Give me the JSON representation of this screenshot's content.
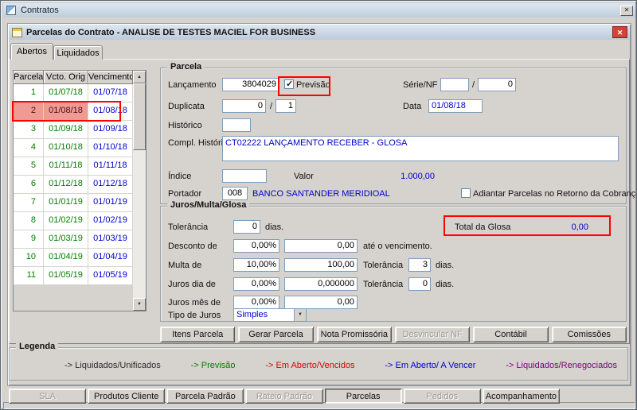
{
  "colors": {
    "annotation": "#ff0000",
    "parcela_number": "#007d00",
    "vcto_date": "#007d00",
    "venc_date": "#0000cc",
    "selected_bg": "#f09a94",
    "blue_value": "#0000cc"
  },
  "icons": {
    "close": "✕",
    "arrow_up": "▲",
    "arrow_down": "▼",
    "combo_arrow": "▼"
  },
  "outer_window": {
    "title": "Contratos"
  },
  "inner_window": {
    "title": "Parcelas do Contrato - ANALISE DE TESTES MACIEL FOR BUSINESS"
  },
  "tabs": {
    "abertos": "Abertos",
    "liquidados": "Liquidados"
  },
  "table": {
    "headers": [
      "Parcela",
      "Vcto. Orig",
      "Vencimento"
    ],
    "rows": [
      {
        "parcela": "1",
        "vcto": "01/07/18",
        "venc": "01/07/18",
        "selected": false
      },
      {
        "parcela": "2",
        "vcto": "01/08/18",
        "venc": "01/08/18",
        "selected": true
      },
      {
        "parcela": "3",
        "vcto": "01/09/18",
        "venc": "01/09/18",
        "selected": false
      },
      {
        "parcela": "4",
        "vcto": "01/10/18",
        "venc": "01/10/18",
        "selected": false
      },
      {
        "parcela": "5",
        "vcto": "01/11/18",
        "venc": "01/11/18",
        "selected": false
      },
      {
        "parcela": "6",
        "vcto": "01/12/18",
        "venc": "01/12/18",
        "selected": false
      },
      {
        "parcela": "7",
        "vcto": "01/01/19",
        "venc": "01/01/19",
        "selected": false
      },
      {
        "parcela": "8",
        "vcto": "01/02/19",
        "venc": "01/02/19",
        "selected": false
      },
      {
        "parcela": "9",
        "vcto": "01/03/19",
        "venc": "01/03/19",
        "selected": false
      },
      {
        "parcela": "10",
        "vcto": "01/04/19",
        "venc": "01/04/19",
        "selected": false
      },
      {
        "parcela": "11",
        "vcto": "01/05/19",
        "venc": "01/05/19",
        "selected": false
      }
    ]
  },
  "parcela": {
    "group_title": "Parcela",
    "lancamento": {
      "label": "Lançamento",
      "value": "3804029"
    },
    "previsao": {
      "label": "Previsão",
      "checked": true
    },
    "serie_nf": {
      "label": "Série/NF",
      "value1": "",
      "sep": "/",
      "value2": "0"
    },
    "duplicata": {
      "label": "Duplicata",
      "value": "0",
      "sep": "/",
      "seq": "1"
    },
    "data": {
      "label": "Data",
      "value": "01/08/18"
    },
    "historico": {
      "label": "Histórico",
      "value": ""
    },
    "compl_historico": {
      "label": "Compl. Histórico",
      "value": "CT02222 LANÇAMENTO RECEBER - GLOSA"
    },
    "indice": {
      "label": "Índice",
      "value": ""
    },
    "valor": {
      "label": "Valor",
      "value": "1.000,00"
    },
    "portador": {
      "label": "Portador",
      "code": "008",
      "name": "BANCO SANTANDER MERIDIOAL"
    },
    "adiantar": {
      "label": "Adiantar Parcelas no Retorno da Cobrança",
      "checked": false
    }
  },
  "juros": {
    "group_title": "Juros/Multa/Glosa",
    "tolerancia": {
      "label": "Tolerância",
      "value": "0",
      "suffix": "dias."
    },
    "total_glosa": {
      "label": "Total da Glosa",
      "value": "0,00"
    },
    "desconto": {
      "label": "Desconto de",
      "pct": "0,00%",
      "value": "0,00",
      "suffix": "até o vencimento."
    },
    "multa": {
      "label": "Multa de",
      "pct": "10,00%",
      "value": "100,00",
      "tol_label": "Tolerância",
      "tol": "3",
      "suffix": "dias."
    },
    "juros_dia": {
      "label": "Juros dia de",
      "pct": "0,00%",
      "value": "0,000000",
      "tol_label": "Tolerância",
      "tol": "0",
      "suffix": "dias."
    },
    "juros_mes": {
      "label": "Juros mês de",
      "pct": "0,00%",
      "value": "0,00"
    },
    "tipo_juros": {
      "label": "Tipo de Juros",
      "value": "Simples"
    }
  },
  "action_buttons": [
    {
      "label": "Itens Parcela",
      "enabled": true
    },
    {
      "label": "Gerar Parcela",
      "enabled": true
    },
    {
      "label": "Nota Promissória",
      "enabled": true
    },
    {
      "label": "Desvincular NF",
      "enabled": false
    },
    {
      "label": "Contábil",
      "enabled": true
    },
    {
      "label": "Comissões",
      "enabled": true
    }
  ],
  "legend": {
    "title": "Legenda",
    "items": [
      {
        "label": "-> Liquidados/Unificados",
        "color": "#2b2b2b"
      },
      {
        "label": "-> Previsão",
        "color": "#008000"
      },
      {
        "label": "-> Em Aberto/Vencidos",
        "color": "#e00000"
      },
      {
        "label": "-> Em Aberto/ A Vencer",
        "color": "#0000d0"
      },
      {
        "label": "-> Liquidados/Renegociados",
        "color": "#800080"
      }
    ]
  },
  "bottom_buttons": [
    {
      "label": "SLA",
      "enabled": false
    },
    {
      "label": "Produtos Cliente",
      "enabled": true
    },
    {
      "label": "Parcela Padrão",
      "enabled": true
    },
    {
      "label": "Rateio Padrão",
      "enabled": false
    },
    {
      "label": "Parcelas",
      "enabled": true,
      "active": true
    },
    {
      "label": "Pedidos",
      "enabled": false
    },
    {
      "label": "Acompanhamento",
      "enabled": true
    }
  ]
}
